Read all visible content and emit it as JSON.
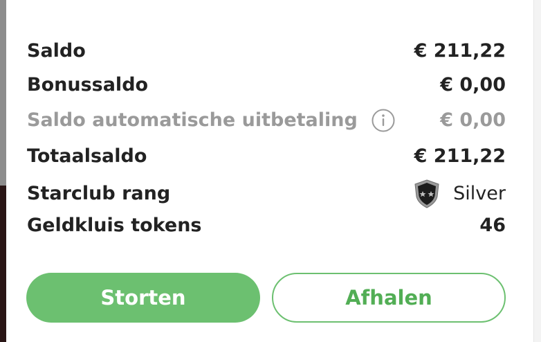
{
  "balance": {
    "rows": [
      {
        "label": "Saldo",
        "value": "€ 211,22"
      },
      {
        "label": "Bonussaldo",
        "value": "€ 0,00"
      },
      {
        "label": "Saldo automatische uitbetaling",
        "value": "€ 0,00"
      },
      {
        "label": "Totaalsaldo",
        "value": "€ 211,22"
      },
      {
        "label": "Starclub rang",
        "value": "Silver"
      },
      {
        "label": "Geldkluis tokens",
        "value": "46"
      }
    ]
  },
  "icons": {
    "info": "info-icon",
    "rank_badge": "silver-star-badge-icon"
  },
  "actions": {
    "deposit_label": "Storten",
    "withdraw_label": "Afhalen"
  },
  "colors": {
    "accent": "#6cc070",
    "muted_text": "#9a9a9a"
  }
}
